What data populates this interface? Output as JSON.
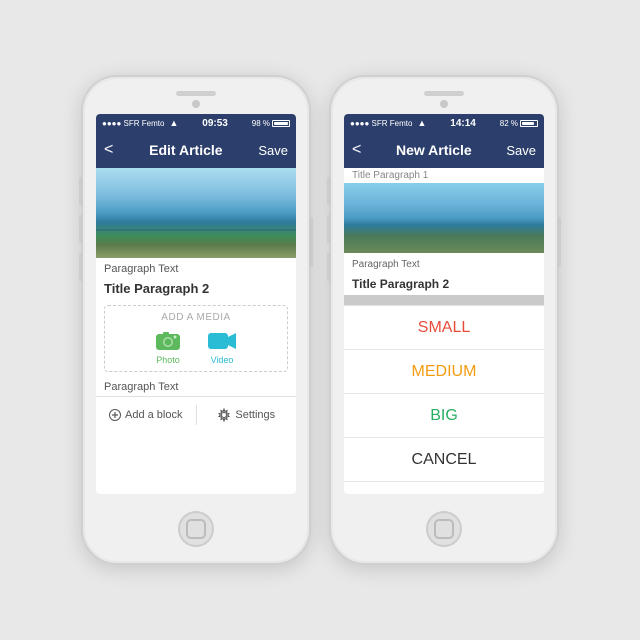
{
  "phone1": {
    "status": {
      "carrier": "●●●● SFR Femto",
      "time": "09:53",
      "battery_pct": "98 %"
    },
    "nav": {
      "back_label": "<",
      "title": "Edit Article",
      "save_label": "Save"
    },
    "content": {
      "paragraph_text_1": "Paragraph Text",
      "title_paragraph_2": "Title Paragraph 2",
      "add_media_label": "ADD A MEDIA",
      "photo_label": "Photo",
      "video_label": "Video",
      "paragraph_text_2": "Paragraph Text"
    },
    "toolbar": {
      "add_block_label": "Add a block",
      "settings_label": "Settings"
    }
  },
  "phone2": {
    "status": {
      "carrier": "●●●● SFR Femto",
      "time": "14:14",
      "battery_pct": "82 %"
    },
    "nav": {
      "back_label": "<",
      "title": "New Article",
      "save_label": "Save"
    },
    "content": {
      "title_paragraph_top": "Title Paragraph 1",
      "paragraph_text_1": "Paragraph Text",
      "title_paragraph_2": "Title Paragraph 2"
    },
    "action_sheet": {
      "small_label": "SMALL",
      "medium_label": "MEDIUM",
      "big_label": "BIG",
      "cancel_label": "CANCEL"
    },
    "colors": {
      "small": "#e74c3c",
      "medium": "#f39c12",
      "big": "#27ae60",
      "cancel": "#333333"
    }
  }
}
